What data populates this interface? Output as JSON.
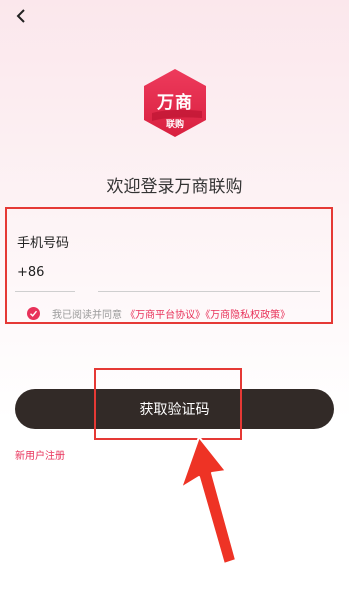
{
  "header": {
    "back_icon": "chevron-left-icon"
  },
  "logo": {
    "line1": "万商",
    "line2": "联购",
    "color": "#e3284f"
  },
  "welcome": "欢迎登录万商联购",
  "form": {
    "phone_label": "手机号码",
    "country_code": "+86",
    "phone_value": ""
  },
  "agreement": {
    "checked": true,
    "prefix": "我已阅读并同意",
    "platform_link": "《万商平台协议》",
    "privacy_link": "《万商隐私权政策》"
  },
  "actions": {
    "get_code": "获取验证码",
    "register": "新用户注册"
  },
  "colors": {
    "accent": "#e8325a",
    "button_bg": "#322a27",
    "annotation": "#e53935"
  }
}
